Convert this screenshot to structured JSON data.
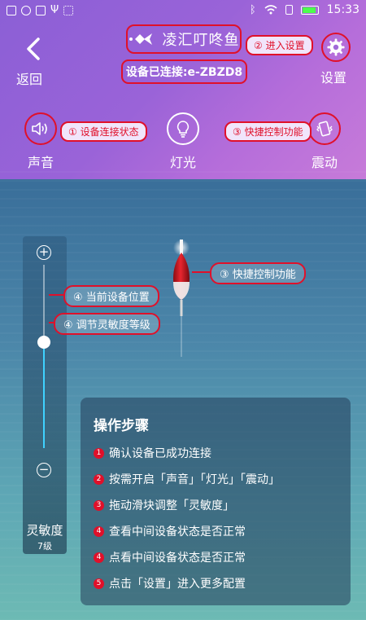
{
  "status_bar": {
    "time": "15:33"
  },
  "header": {
    "back_label": "返回",
    "app_name": "凌汇叮咚鱼",
    "connection_status": "设备已连接:e-ZBZD8",
    "settings_label": "设置",
    "note_settings": "② 进入设置"
  },
  "controls": [
    {
      "label": "声音",
      "icon": "speaker-icon",
      "note": "① 设备连接状态"
    },
    {
      "label": "灯光",
      "icon": "bulb-icon",
      "note": ""
    },
    {
      "label": "震动",
      "icon": "vibrate-icon",
      "note": "③ 快捷控制功能"
    }
  ],
  "callouts": {
    "float_note": "③ 快捷控制功能",
    "position_note": "④ 当前设备位置",
    "sensitivity_note": "④ 调节灵敏度等级"
  },
  "slider": {
    "label": "灵敏度",
    "level": "7级",
    "plus": "+",
    "minus": "−",
    "value_fraction": 0.58
  },
  "steps": {
    "title": "操作步骤",
    "items": [
      {
        "num": "1",
        "text": "确认设备已成功连接"
      },
      {
        "num": "2",
        "text": "按需开启「声音」「灯光」「震动」"
      },
      {
        "num": "3",
        "text": "拖动滑块调整「灵敏度」"
      },
      {
        "num": "4",
        "text": "查看中间设备状态是否正常"
      },
      {
        "num": "4",
        "text": "点看中间设备状态是否正常"
      },
      {
        "num": "5",
        "text": "点击「设置」进入更多配置"
      }
    ]
  },
  "colors": {
    "accent_red": "#e0102a",
    "header_purple": "#9a63d8",
    "slider_blue": "#3fd2ff"
  }
}
